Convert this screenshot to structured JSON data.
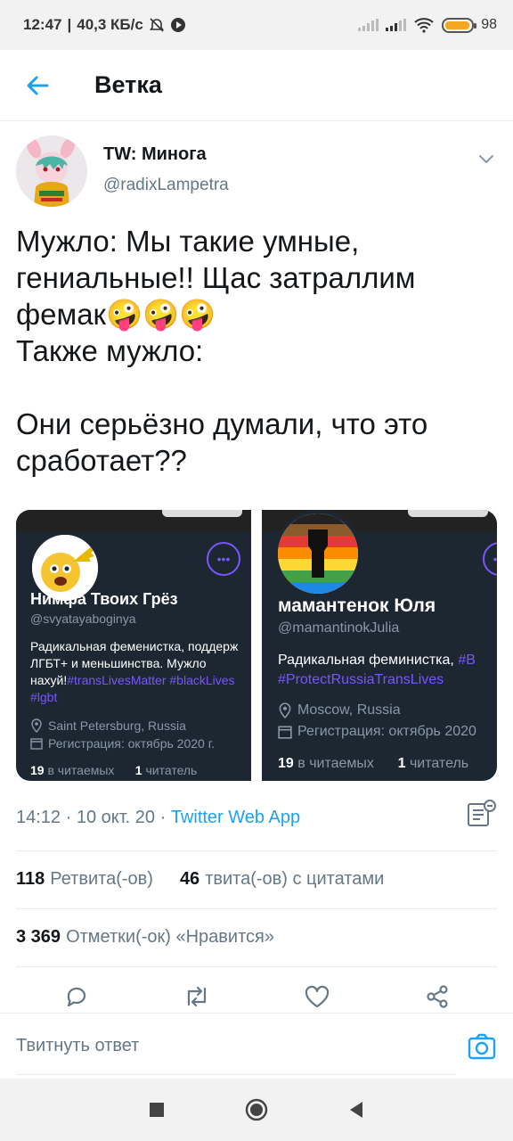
{
  "status_bar": {
    "time": "12:47",
    "speed": "40,3 КБ/с",
    "battery": "98"
  },
  "header": {
    "title": "Ветка"
  },
  "tweet": {
    "author_name": "TW: Минога",
    "author_handle": "@radixLampetra",
    "text": "Мужло: Мы такие умные, гениальные!! Щас затраллим фемак🤪🤪🤪\nТакже мужло:\n\nОни серьёзно думали, что это сработает??",
    "timestamp": "14:12 · 10 окт. 20 · ",
    "source": "Twitter Web App"
  },
  "media": {
    "cards": [
      {
        "name": "Нимфа Твоих Грёз",
        "handle": "@svyatayaboginya",
        "bio": "Радикальная феменистка, поддерж ЛГБТ+ и меньшинства. Мужло нахуй!",
        "tags": "#transLivesMatter #blackLives #lgbt",
        "location": "Saint Petersburg, Russia",
        "joined": "Регистрация: октябрь 2020 г.",
        "following": "19",
        "following_label": "в читаемых",
        "followers": "1",
        "followers_label": "читатель"
      },
      {
        "name": "мамантенок Юля",
        "handle": "@mamantinokJulia",
        "bio": "Радикальная феминистка, ",
        "tags": "#B #ProtectRussiaTransLives",
        "location": "Moscow, Russia",
        "joined": "Регистрация: октябрь 2020",
        "following": "19",
        "following_label": "в читаемых",
        "followers": "1",
        "followers_label": "читатель"
      }
    ]
  },
  "stats": {
    "retweets_count": "118",
    "retweets_label": "Ретвита(-ов)",
    "quotes_count": "46",
    "quotes_label": "твита(-ов) с цитатами",
    "likes_count": "3 369",
    "likes_label": "Отметки(-ок) «Нравится»"
  },
  "reply": {
    "placeholder": "Твитнуть ответ"
  },
  "icons": {
    "back": "arrow-left-icon",
    "chevron": "chevron-down-icon",
    "reply": "comment-icon",
    "retweet": "retweet-icon",
    "like": "heart-icon",
    "share": "share-icon",
    "camera": "camera-icon",
    "analytics": "analytics-icon"
  },
  "colors": {
    "accent": "#1da1f2",
    "card_bg": "#1c2732",
    "purple": "#7856ff",
    "muted": "#657786"
  }
}
